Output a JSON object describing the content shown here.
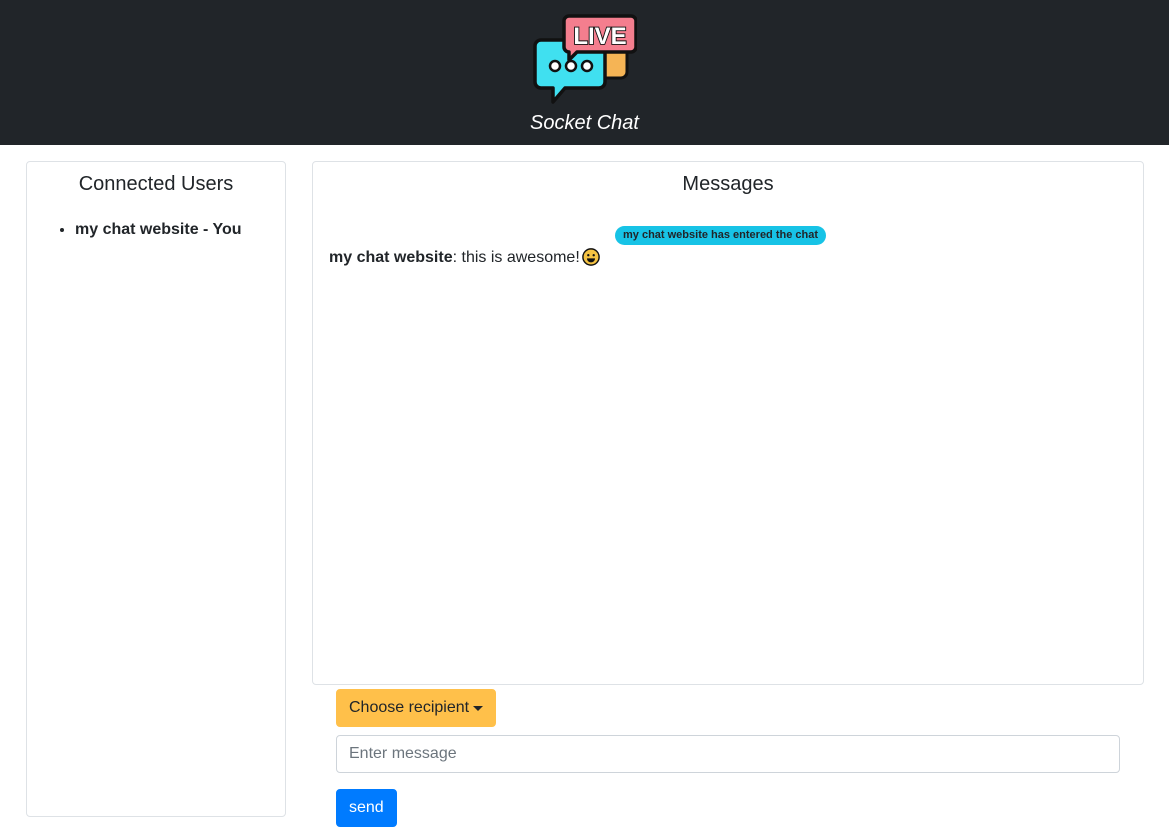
{
  "app": {
    "logo_text": "LIVE",
    "title": "Socket Chat"
  },
  "users_panel": {
    "title": "Connected Users",
    "users": [
      {
        "label": "my chat website - You"
      }
    ]
  },
  "messages_panel": {
    "title": "Messages",
    "system_notice": "my chat website has entered the chat",
    "messages": [
      {
        "sender": "my chat website",
        "separator": ": ",
        "text": "this is awesome!",
        "emoji": "grinning-face"
      }
    ]
  },
  "composer": {
    "recipient_label": "Choose recipient",
    "message_placeholder": "Enter message",
    "message_value": "",
    "send_label": "send"
  },
  "colors": {
    "header_bg": "#212529",
    "badge_bg": "#17c3e6",
    "recipient_bg": "#ffc04a",
    "send_bg": "#007bff",
    "logo_pink": "#f47e8e",
    "logo_cyan": "#40e0f0",
    "logo_orange": "#f5b455"
  },
  "icons": {
    "logo": "live-chat-bubble-icon",
    "dropdown": "caret-down-icon"
  }
}
